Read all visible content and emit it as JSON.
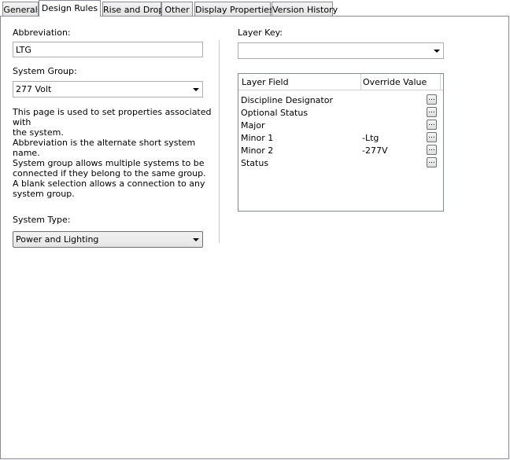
{
  "tabs": [
    {
      "label": "General"
    },
    {
      "label": "Design Rules",
      "active": true
    },
    {
      "label": "Rise and Drop"
    },
    {
      "label": "Other"
    },
    {
      "label": "Display Properties"
    },
    {
      "label": "Version History"
    }
  ],
  "left": {
    "abbreviation_label": "Abbreviation:",
    "abbreviation_value": "LTG",
    "system_group_label": "System Group:",
    "system_group_value": "277 Volt",
    "desc1_line1": "This page is used to set properties associated with",
    "desc1_line2": "the system.",
    "desc2": "Abbreviation is the alternate short system name.",
    "desc3_line1": "System group allows multiple systems to be",
    "desc3_line2": "connected if they belong to the same group.",
    "desc3_line3": "A blank selection allows a connection to any",
    "desc3_line4": "system group.",
    "system_type_label": "System Type:",
    "system_type_value": "Power and Lighting"
  },
  "right": {
    "layer_key_label": "Layer Key:",
    "layer_key_value": "",
    "grid": {
      "col_field": "Layer Field",
      "col_override": "Override Value",
      "button_label": "...",
      "rows": [
        {
          "field": "Discipline Designator",
          "value": ""
        },
        {
          "field": "Optional Status",
          "value": ""
        },
        {
          "field": "Major",
          "value": ""
        },
        {
          "field": "Minor 1",
          "value": "-Ltg"
        },
        {
          "field": "Minor 2",
          "value": "-277V"
        },
        {
          "field": "Status",
          "value": ""
        }
      ]
    }
  },
  "icons": {
    "dropdown_arrow": "chevron-down-icon"
  }
}
